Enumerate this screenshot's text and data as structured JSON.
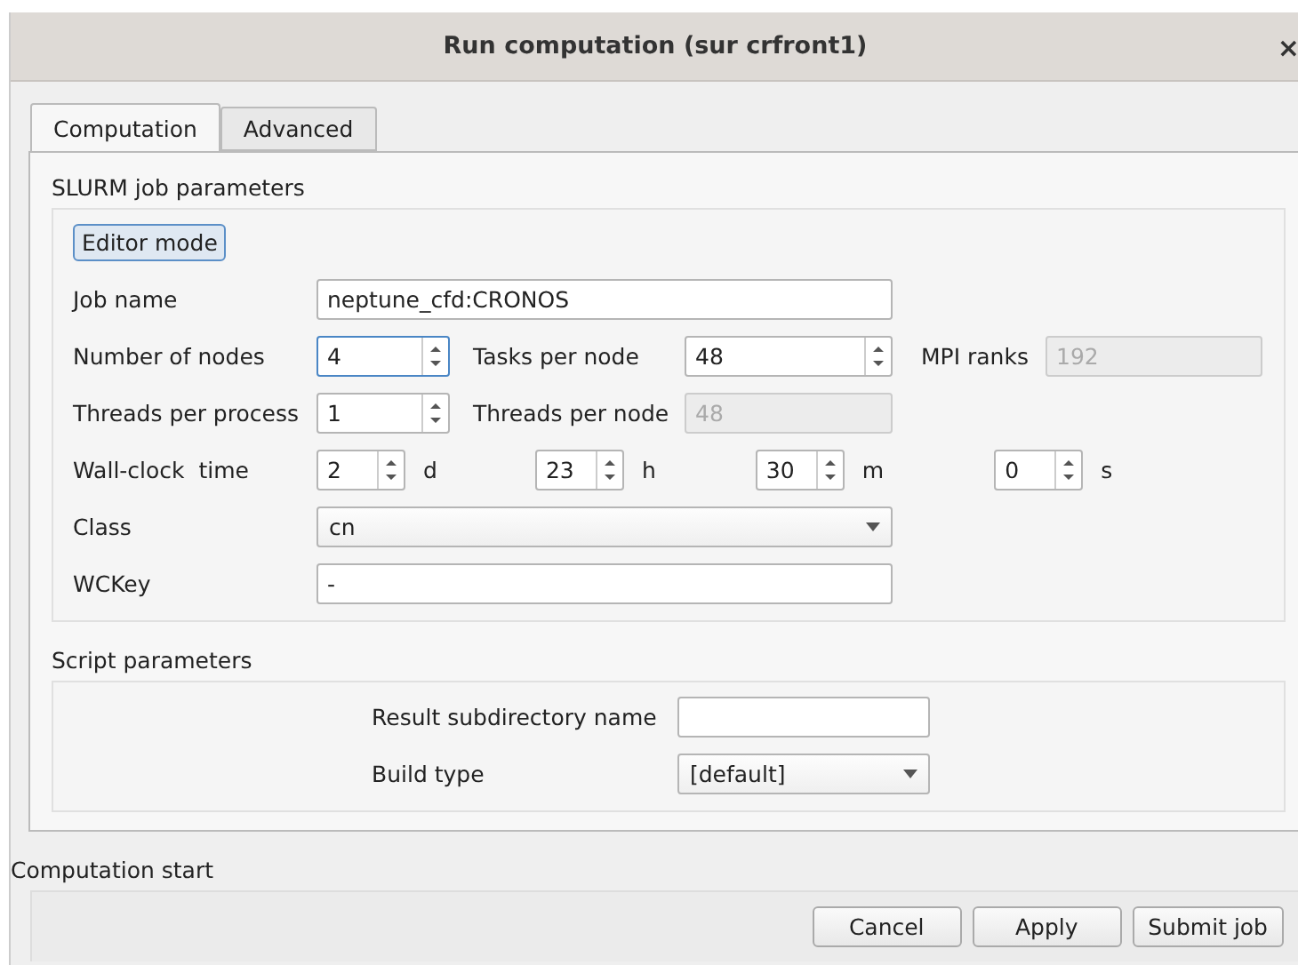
{
  "window": {
    "title": "Run computation (sur crfront1)",
    "close": "×"
  },
  "tabs": [
    {
      "label": "Computation",
      "selected": true
    },
    {
      "label": "Advanced",
      "selected": false
    }
  ],
  "slurm": {
    "title": "SLURM job parameters",
    "editor_button": "Editor mode",
    "job_name": {
      "label": "Job name",
      "value": "neptune_cfd:CRONOS"
    },
    "nodes": {
      "label": "Number of nodes",
      "value": "4",
      "focused": true
    },
    "tasks": {
      "label": "Tasks per node",
      "value": "48",
      "focused": false
    },
    "mpi": {
      "label": "MPI ranks",
      "value": "192",
      "disabled": true
    },
    "threads": {
      "label": "Threads per process",
      "value": "1",
      "focused": false
    },
    "threads_node": {
      "label": "Threads per node",
      "value": "48",
      "disabled": true
    },
    "wall": {
      "label": "Wall-clock  time",
      "parts": [
        {
          "value": "2",
          "unit": "d"
        },
        {
          "value": "23",
          "unit": "h"
        },
        {
          "value": "30",
          "unit": "m"
        },
        {
          "value": "0",
          "unit": "s"
        }
      ]
    },
    "class": {
      "label": "Class",
      "value": "cn"
    },
    "wckey": {
      "label": "WCKey",
      "value": "-"
    }
  },
  "script": {
    "title": "Script parameters",
    "result": {
      "label": "Result subdirectory name"
    },
    "build": {
      "label": "Build type",
      "value": "[default]"
    }
  },
  "start": {
    "title": "Computation start",
    "buttons": [
      "Cancel",
      "Apply",
      "Submit job"
    ]
  }
}
